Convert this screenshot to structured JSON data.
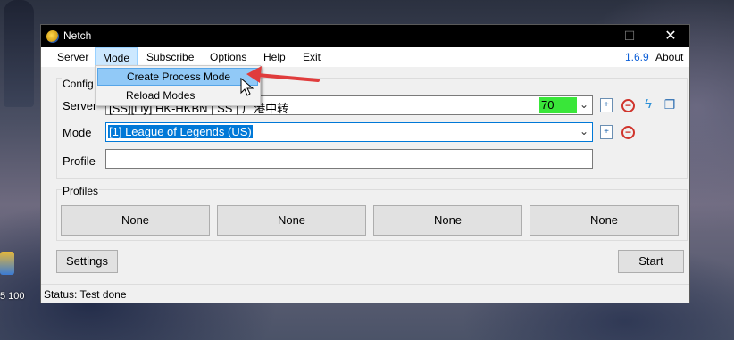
{
  "desktop": {
    "icon_label": "5 100"
  },
  "window": {
    "title": "Netch",
    "controls": {
      "minimize": "—",
      "maximize": "☐",
      "close": "✕"
    }
  },
  "menu": {
    "server": "Server",
    "mode": "Mode",
    "subscribe": "Subscribe",
    "options": "Options",
    "help": "Help",
    "exit": "Exit",
    "version": "1.6.9",
    "about": "About"
  },
  "mode_menu": {
    "items": [
      "Create Process Mode",
      "Reload Modes"
    ],
    "highlighted": "Create Process Mode"
  },
  "config": {
    "group_title": "Config",
    "server_label": "Server",
    "server_value": "[SS][Lly] HK-HKBN | SS | 广港中转",
    "server_latency": "70",
    "mode_label": "Mode",
    "mode_value": "[1] League of Legends (US)",
    "profile_label": "Profile",
    "profile_value": ""
  },
  "profiles": {
    "group_title": "Profiles",
    "buttons": [
      "None",
      "None",
      "None",
      "None"
    ]
  },
  "actions": {
    "settings": "Settings",
    "start": "Start"
  },
  "status": {
    "text": "Status: Test done"
  },
  "colors": {
    "latency_bg": "#39e639",
    "selection": "#0078d7",
    "version_link": "#0b5ed7",
    "annotation_arrow": "#e03c3c"
  }
}
